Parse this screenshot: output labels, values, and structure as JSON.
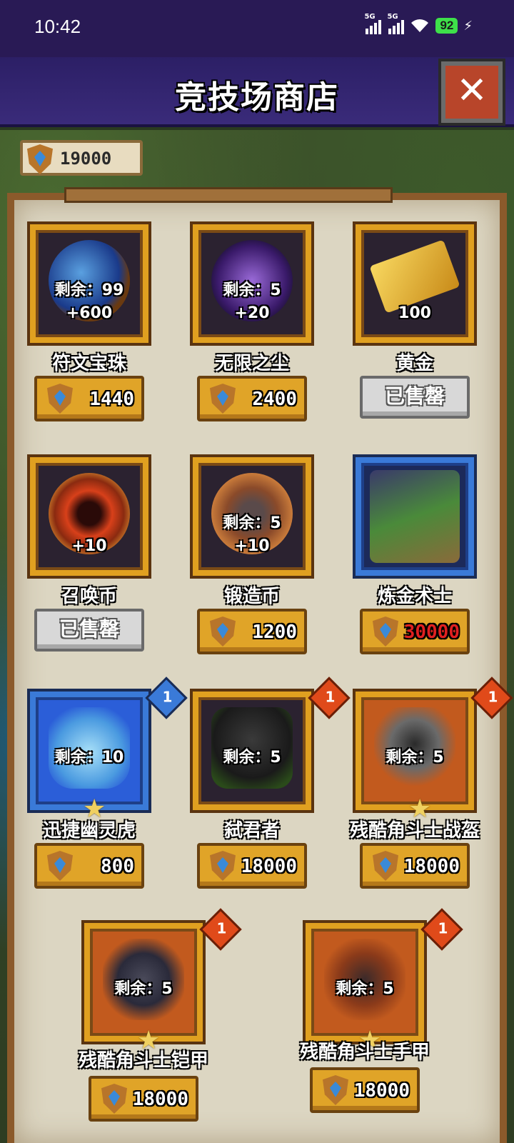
{
  "status_bar": {
    "time": "10:42",
    "sig1": "5G",
    "sig2": "5G",
    "battery": "92"
  },
  "header": {
    "title": "竞技场商店",
    "close_glyph": "✕"
  },
  "currency": {
    "value": "19000",
    "icon": "shield-gem-icon"
  },
  "colors": {
    "gold": "#e0a428",
    "frame_gold": "#e0a020",
    "frame_blue": "#3a7ad8",
    "header": "#2c1f66",
    "price_red": "#e02020"
  },
  "items": [
    {
      "name": "符文宝珠",
      "remaining": "剩余：99",
      "qty": "+600",
      "price": "1440"
    },
    {
      "name": "无限之尘",
      "remaining": "剩余：5",
      "qty": "+20",
      "price": "2400"
    },
    {
      "name": "黄金",
      "qty": "100",
      "sold": "已售罄"
    },
    {
      "name": "召唤币",
      "qty": "+10",
      "sold": "已售罄"
    },
    {
      "name": "锻造币",
      "remaining": "剩余：5",
      "qty": "+10",
      "price": "1200"
    },
    {
      "name": "炼金术士",
      "price": "30000"
    },
    {
      "name": "迅捷幽灵虎",
      "remaining": "剩余：10",
      "badge": "1",
      "price": "800"
    },
    {
      "name": "弑君者",
      "remaining": "剩余：5",
      "badge": "1",
      "price": "18000"
    },
    {
      "name": "残酷角斗士战盔",
      "remaining": "剩余：5",
      "badge": "1",
      "price": "18000"
    },
    {
      "name": "残酷角斗士铠甲",
      "remaining": "剩余：5",
      "badge": "1",
      "price": "18000"
    },
    {
      "name": "残酷角斗士手甲",
      "remaining": "剩余：5",
      "badge": "1",
      "price": "18000"
    }
  ]
}
